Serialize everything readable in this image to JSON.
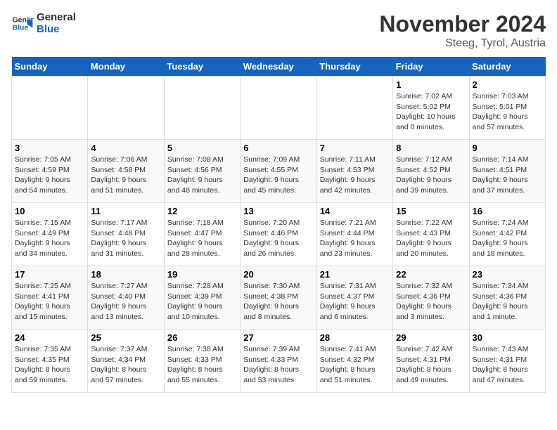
{
  "header": {
    "logo_line1": "General",
    "logo_line2": "Blue",
    "title": "November 2024",
    "subtitle": "Steeg, Tyrol, Austria"
  },
  "calendar": {
    "days_of_week": [
      "Sunday",
      "Monday",
      "Tuesday",
      "Wednesday",
      "Thursday",
      "Friday",
      "Saturday"
    ],
    "weeks": [
      [
        {
          "day": "",
          "info": ""
        },
        {
          "day": "",
          "info": ""
        },
        {
          "day": "",
          "info": ""
        },
        {
          "day": "",
          "info": ""
        },
        {
          "day": "",
          "info": ""
        },
        {
          "day": "1",
          "info": "Sunrise: 7:02 AM\nSunset: 5:02 PM\nDaylight: 10 hours\nand 0 minutes."
        },
        {
          "day": "2",
          "info": "Sunrise: 7:03 AM\nSunset: 5:01 PM\nDaylight: 9 hours\nand 57 minutes."
        }
      ],
      [
        {
          "day": "3",
          "info": "Sunrise: 7:05 AM\nSunset: 4:59 PM\nDaylight: 9 hours\nand 54 minutes."
        },
        {
          "day": "4",
          "info": "Sunrise: 7:06 AM\nSunset: 4:58 PM\nDaylight: 9 hours\nand 51 minutes."
        },
        {
          "day": "5",
          "info": "Sunrise: 7:08 AM\nSunset: 4:56 PM\nDaylight: 9 hours\nand 48 minutes."
        },
        {
          "day": "6",
          "info": "Sunrise: 7:09 AM\nSunset: 4:55 PM\nDaylight: 9 hours\nand 45 minutes."
        },
        {
          "day": "7",
          "info": "Sunrise: 7:11 AM\nSunset: 4:53 PM\nDaylight: 9 hours\nand 42 minutes."
        },
        {
          "day": "8",
          "info": "Sunrise: 7:12 AM\nSunset: 4:52 PM\nDaylight: 9 hours\nand 39 minutes."
        },
        {
          "day": "9",
          "info": "Sunrise: 7:14 AM\nSunset: 4:51 PM\nDaylight: 9 hours\nand 37 minutes."
        }
      ],
      [
        {
          "day": "10",
          "info": "Sunrise: 7:15 AM\nSunset: 4:49 PM\nDaylight: 9 hours\nand 34 minutes."
        },
        {
          "day": "11",
          "info": "Sunrise: 7:17 AM\nSunset: 4:48 PM\nDaylight: 9 hours\nand 31 minutes."
        },
        {
          "day": "12",
          "info": "Sunrise: 7:18 AM\nSunset: 4:47 PM\nDaylight: 9 hours\nand 28 minutes."
        },
        {
          "day": "13",
          "info": "Sunrise: 7:20 AM\nSunset: 4:46 PM\nDaylight: 9 hours\nand 26 minutes."
        },
        {
          "day": "14",
          "info": "Sunrise: 7:21 AM\nSunset: 4:44 PM\nDaylight: 9 hours\nand 23 minutes."
        },
        {
          "day": "15",
          "info": "Sunrise: 7:22 AM\nSunset: 4:43 PM\nDaylight: 9 hours\nand 20 minutes."
        },
        {
          "day": "16",
          "info": "Sunrise: 7:24 AM\nSunset: 4:42 PM\nDaylight: 9 hours\nand 18 minutes."
        }
      ],
      [
        {
          "day": "17",
          "info": "Sunrise: 7:25 AM\nSunset: 4:41 PM\nDaylight: 9 hours\nand 15 minutes."
        },
        {
          "day": "18",
          "info": "Sunrise: 7:27 AM\nSunset: 4:40 PM\nDaylight: 9 hours\nand 13 minutes."
        },
        {
          "day": "19",
          "info": "Sunrise: 7:28 AM\nSunset: 4:39 PM\nDaylight: 9 hours\nand 10 minutes."
        },
        {
          "day": "20",
          "info": "Sunrise: 7:30 AM\nSunset: 4:38 PM\nDaylight: 9 hours\nand 8 minutes."
        },
        {
          "day": "21",
          "info": "Sunrise: 7:31 AM\nSunset: 4:37 PM\nDaylight: 9 hours\nand 6 minutes."
        },
        {
          "day": "22",
          "info": "Sunrise: 7:32 AM\nSunset: 4:36 PM\nDaylight: 9 hours\nand 3 minutes."
        },
        {
          "day": "23",
          "info": "Sunrise: 7:34 AM\nSunset: 4:36 PM\nDaylight: 9 hours\nand 1 minute."
        }
      ],
      [
        {
          "day": "24",
          "info": "Sunrise: 7:35 AM\nSunset: 4:35 PM\nDaylight: 8 hours\nand 59 minutes."
        },
        {
          "day": "25",
          "info": "Sunrise: 7:37 AM\nSunset: 4:34 PM\nDaylight: 8 hours\nand 57 minutes."
        },
        {
          "day": "26",
          "info": "Sunrise: 7:38 AM\nSunset: 4:33 PM\nDaylight: 8 hours\nand 55 minutes."
        },
        {
          "day": "27",
          "info": "Sunrise: 7:39 AM\nSunset: 4:33 PM\nDaylight: 8 hours\nand 53 minutes."
        },
        {
          "day": "28",
          "info": "Sunrise: 7:41 AM\nSunset: 4:32 PM\nDaylight: 8 hours\nand 51 minutes."
        },
        {
          "day": "29",
          "info": "Sunrise: 7:42 AM\nSunset: 4:31 PM\nDaylight: 8 hours\nand 49 minutes."
        },
        {
          "day": "30",
          "info": "Sunrise: 7:43 AM\nSunset: 4:31 PM\nDaylight: 8 hours\nand 47 minutes."
        }
      ]
    ]
  }
}
